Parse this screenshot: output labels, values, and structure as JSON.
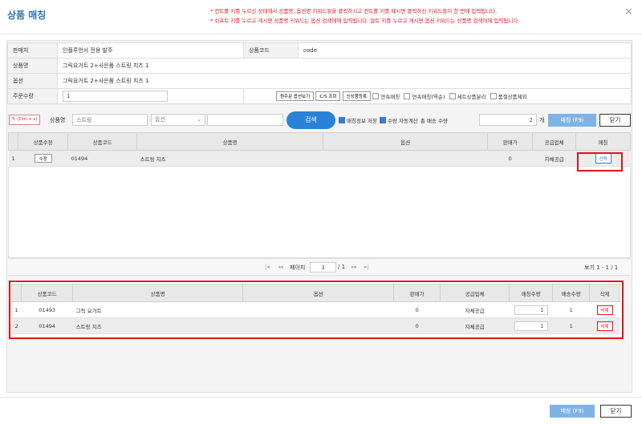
{
  "title": "상품 매칭",
  "notices": [
    "* 컨트롤 키를 누르신 상태에서 상품명, 옵션명 키워드들을 클릭하시고 컨트롤 키를 떼시면 클릭하신 키워드들이 한 번에 입력됩니다.",
    "* 쉬프트 키를 누르고 게시면 상품명 키워드는 옵션 검색에에 입력됩니다. 알트 키를 누르고 게시면 옵션 키워드는 상품명 검색어에 입력됩니다."
  ],
  "info": {
    "seller_label": "판매처",
    "seller": "인플루언서 전용 발주",
    "code_label": "상품코드",
    "code": "code",
    "name_label": "상품명",
    "name": "그릭요거트 2+사은품 스트링 치즈 1",
    "option_label": "옵션",
    "option": "그릭요거트 2+사은품 스트링 치즈 1",
    "qty_label": "주문수량",
    "qty": "1"
  },
  "tools": {
    "orig_option": "원주문 옵션보기",
    "cs": "C/S 조회",
    "new_product": "신상품등록",
    "c1": "연속매칭",
    "c2": "연속매칭(역순)",
    "c3": "세트상품분리",
    "c4": "품절상품제외"
  },
  "ctrl": {
    "ctrl_btn": "(Ctrl + s)",
    "product_label": "상품명",
    "product_ph": "스트링",
    "option_select": "옵션",
    "search": "검색",
    "save_match": "매칭정보 저장",
    "auto_calc": "수량 자동계산",
    "total_label": "총 배송 수량",
    "total": "2",
    "unit": "개",
    "match": "매칭 (F9)",
    "close": "닫기"
  },
  "grid1": {
    "headers": [
      "상품수정",
      "상품코드",
      "상품명",
      "옵션",
      "판매가",
      "공급업체",
      "매칭"
    ],
    "rows": [
      {
        "no": "1",
        "edit": "수정",
        "code": "01494",
        "name": "스트링 치즈",
        "option": "",
        "price": "0",
        "supplier": "자체공급",
        "match": "선택"
      }
    ]
  },
  "pager": {
    "first": "|◂",
    "prev": "◂◂",
    "page_label": "페이지",
    "page": "3",
    "sep": "/ 1",
    "next": "▸▸",
    "last": "▸|",
    "view": "보기 1 - 1 / 1"
  },
  "grid2": {
    "headers": [
      "상품코드",
      "상품명",
      "옵션",
      "판매가",
      "공급업체",
      "매칭수량",
      "배송수량",
      "삭제"
    ],
    "rows": [
      {
        "no": "1",
        "code": "01493",
        "name": "그릭 요거트",
        "option": "",
        "price": "0",
        "supplier": "자체공급",
        "qty": "1",
        "ship": "1",
        "del": "삭제"
      },
      {
        "no": "2",
        "code": "01494",
        "name": "스트링 치즈",
        "option": "",
        "price": "0",
        "supplier": "자체공급",
        "qty": "1",
        "ship": "1",
        "del": "삭제"
      }
    ]
  },
  "footer": {
    "match": "매칭 (F9)",
    "close": "닫기"
  }
}
